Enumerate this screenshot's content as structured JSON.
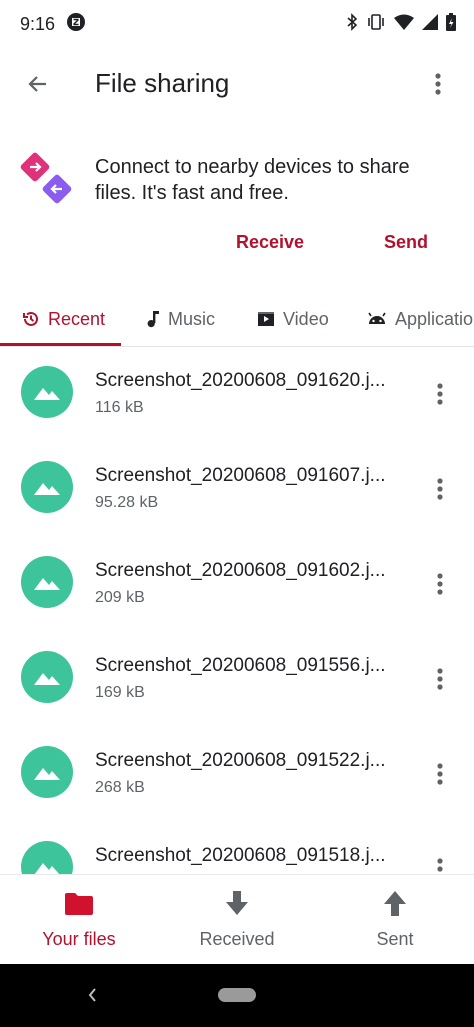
{
  "status_bar": {
    "time": "9:16"
  },
  "app_bar": {
    "title": "File sharing"
  },
  "promo": {
    "text": "Connect to nearby devices to share files. It's fast and free."
  },
  "actions": {
    "receive_label": "Receive",
    "send_label": "Send"
  },
  "tabs": [
    {
      "label": "Recent",
      "icon": "history-icon",
      "active": true
    },
    {
      "label": "Music",
      "icon": "music-note-icon",
      "active": false
    },
    {
      "label": "Video",
      "icon": "video-icon",
      "active": false
    },
    {
      "label": "Applications",
      "icon": "android-icon",
      "active": false
    }
  ],
  "files": [
    {
      "name": "Screenshot_20200608_091620.j...",
      "size": "116 kB",
      "icon": "image-icon"
    },
    {
      "name": "Screenshot_20200608_091607.j...",
      "size": "95.28 kB",
      "icon": "image-icon"
    },
    {
      "name": "Screenshot_20200608_091602.j...",
      "size": "209 kB",
      "icon": "image-icon"
    },
    {
      "name": "Screenshot_20200608_091556.j...",
      "size": "169 kB",
      "icon": "image-icon"
    },
    {
      "name": "Screenshot_20200608_091522.j...",
      "size": "268 kB",
      "icon": "image-icon"
    },
    {
      "name": "Screenshot_20200608_091518.j...",
      "size": "",
      "icon": "image-icon"
    }
  ],
  "bottom_nav": [
    {
      "label": "Your files",
      "icon": "folder-icon",
      "active": true
    },
    {
      "label": "Received",
      "icon": "download-icon",
      "active": false
    },
    {
      "label": "Sent",
      "icon": "upload-icon",
      "active": false
    }
  ],
  "colors": {
    "accent": "#b0122e",
    "thumb": "#3ec49b",
    "text_primary": "#202124",
    "text_secondary": "#5f6368"
  }
}
